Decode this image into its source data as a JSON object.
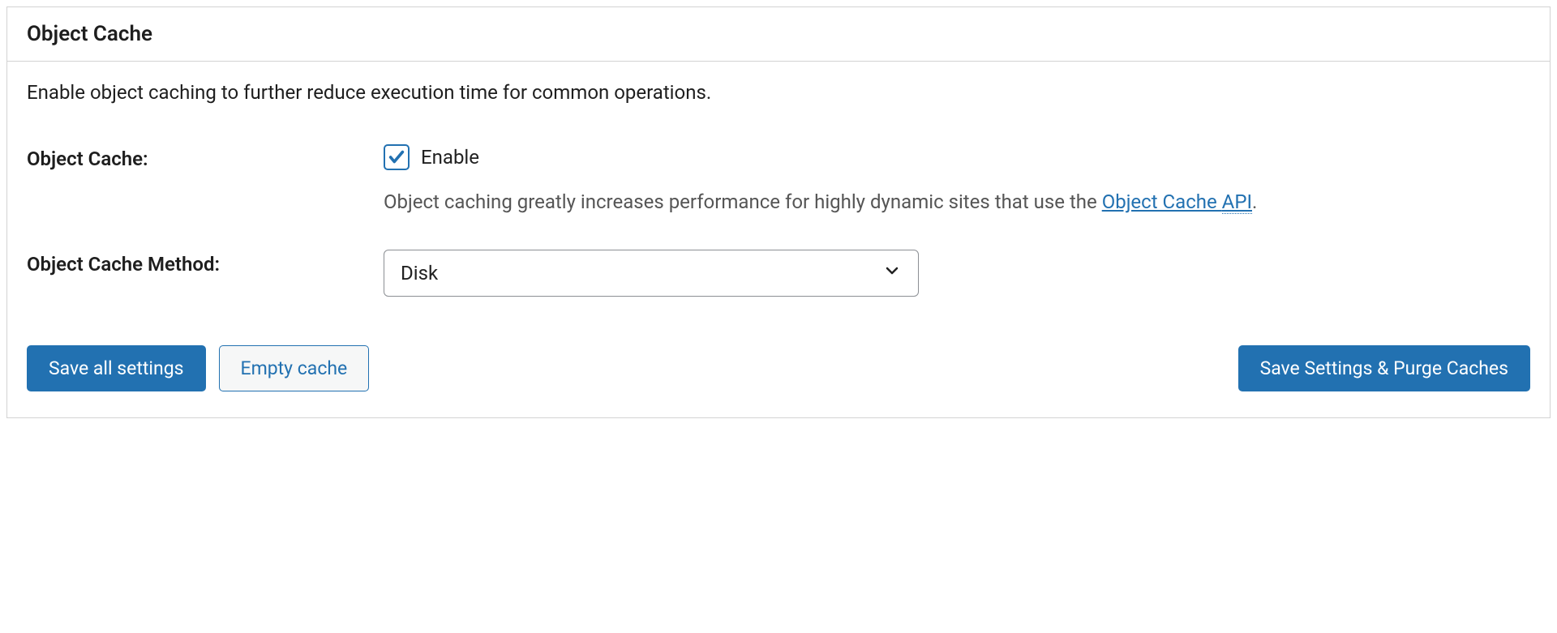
{
  "panel": {
    "title": "Object Cache",
    "description": "Enable object caching to further reduce execution time for common operations."
  },
  "objectCache": {
    "label": "Object Cache:",
    "checkboxLabel": "Enable",
    "checked": true,
    "hintPrefix": "Object caching greatly increases performance for highly dynamic sites that use the ",
    "hintLinkPrefix": "Object Cache ",
    "hintLinkAbbr": "API",
    "hintSuffix": "."
  },
  "method": {
    "label": "Object Cache Method:",
    "selected": "Disk"
  },
  "buttons": {
    "saveAll": "Save all settings",
    "emptyCache": "Empty cache",
    "savePurge": "Save Settings & Purge Caches"
  }
}
